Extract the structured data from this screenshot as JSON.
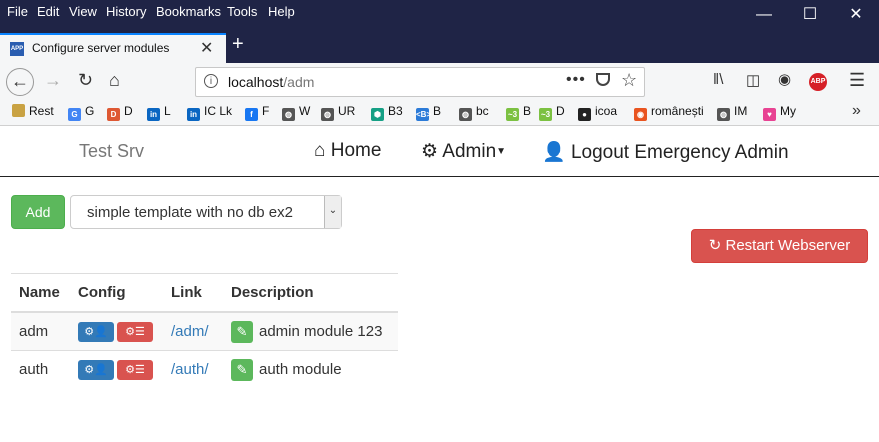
{
  "menubar": {
    "items": [
      "File",
      "Edit",
      "View",
      "History",
      "Bookmarks",
      "Tools",
      "Help"
    ]
  },
  "tab": {
    "title": "Configure server modules"
  },
  "url": {
    "host": "localhost",
    "path": "/adm"
  },
  "bookmarks": [
    {
      "label": "Rest",
      "icon": "folder-icon",
      "color": "#c9a243"
    },
    {
      "label": "G",
      "icon": "google-icon",
      "color": "#4285f4"
    },
    {
      "label": "D",
      "icon": "duckduckgo-icon",
      "color": "#de5833"
    },
    {
      "label": "L",
      "icon": "linkedin-icon",
      "color": "#0a66c2"
    },
    {
      "label": "IC Lk",
      "icon": "linkedin-icon",
      "color": "#0a66c2"
    },
    {
      "label": "F",
      "icon": "facebook-icon",
      "color": "#1877f2"
    },
    {
      "label": "W",
      "icon": "globe-icon",
      "color": "#555555"
    },
    {
      "label": "UR",
      "icon": "globe-icon",
      "color": "#555555"
    },
    {
      "label": "B3",
      "icon": "b3-icon",
      "color": "#16a085"
    },
    {
      "label": "B",
      "icon": "b-icon",
      "color": "#2c7bd8"
    },
    {
      "label": "bc",
      "icon": "globe-icon",
      "color": "#555555"
    },
    {
      "label": "B",
      "icon": "b-green-icon",
      "color": "#7cc142"
    },
    {
      "label": "D",
      "icon": "d-green-icon",
      "color": "#7cc142"
    },
    {
      "label": "icoa",
      "icon": "github-icon",
      "color": "#222222"
    },
    {
      "label": "românești",
      "icon": "ubuntu-icon",
      "color": "#e95420"
    },
    {
      "label": "IM",
      "icon": "globe-icon",
      "color": "#555555"
    },
    {
      "label": "My",
      "icon": "heart-icon",
      "color": "#e84393"
    }
  ],
  "appnav": {
    "brand": "Test Srv",
    "home": "Home",
    "admin": "Admin",
    "logout": "Logout Emergency Admin"
  },
  "controls": {
    "add": "Add",
    "template": "simple template with no db ex2",
    "restart": "Restart Webserver"
  },
  "table": {
    "headers": [
      "Name",
      "Config",
      "Link",
      "Description"
    ],
    "rows": [
      {
        "name": "adm",
        "link": "/adm/",
        "description": "admin module 123"
      },
      {
        "name": "auth",
        "link": "/auth/",
        "description": "auth module"
      }
    ]
  }
}
